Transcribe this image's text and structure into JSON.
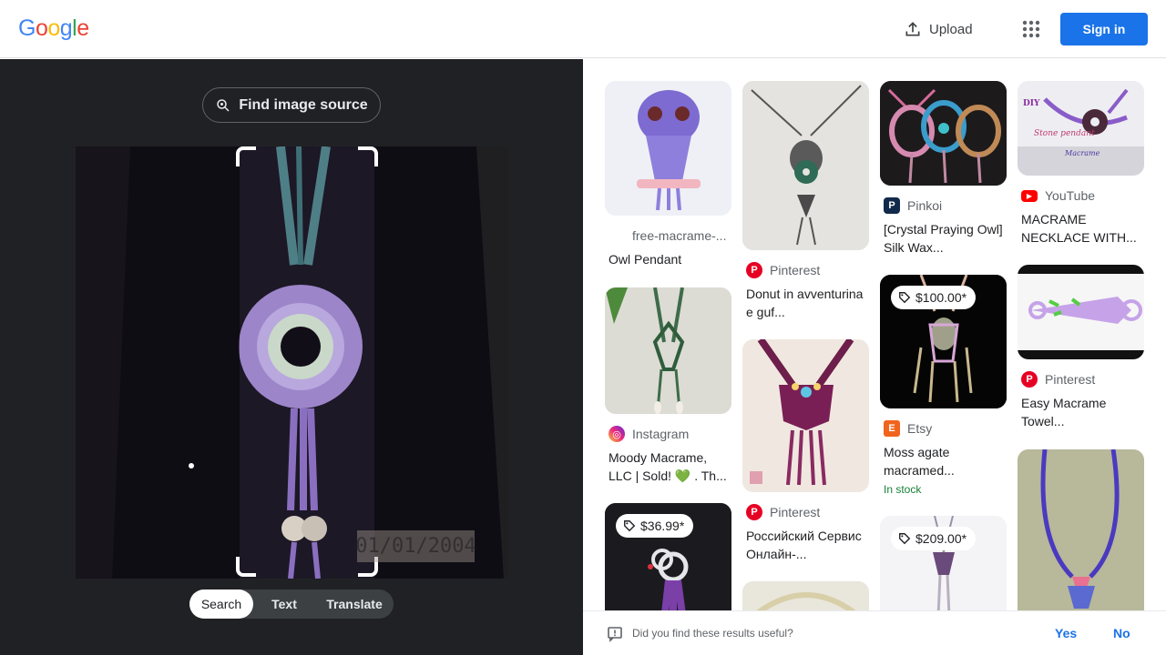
{
  "header": {
    "logo_letters": [
      "G",
      "o",
      "o",
      "g",
      "l",
      "e"
    ],
    "upload_label": "Upload",
    "signin_label": "Sign in"
  },
  "viewer": {
    "find_source_label": "Find image source",
    "datestamp": "01/01/2004",
    "modes": [
      "Search",
      "Text",
      "Translate"
    ],
    "active_mode": "Search"
  },
  "results": [
    {
      "source": "free-macrame-...",
      "title": "Owl Pendant",
      "price": "",
      "stock": "",
      "favicon": "none"
    },
    {
      "source": "Pinterest",
      "title": "Donut in avventurina e guf...",
      "price": "",
      "stock": "",
      "favicon": "pinterest"
    },
    {
      "source": "Pinkoi",
      "title": "[Crystal Praying Owl] Silk Wax...",
      "price": "",
      "stock": "",
      "favicon": "pinkoi"
    },
    {
      "source": "YouTube",
      "title": "MACRAME NECKLACE WITH...",
      "price": "",
      "stock": "",
      "favicon": "youtube",
      "thumb_text": [
        "DIY",
        "Stone pendant",
        "Macrame"
      ]
    },
    {
      "source": "Instagram",
      "title": "Moody Macrame, LLC | Sold! 💚 . Th...",
      "price": "",
      "stock": "",
      "favicon": "instagram"
    },
    {
      "source": "Pinterest",
      "title": "Российский Сервис Онлайн-...",
      "price": "",
      "stock": "",
      "favicon": "pinterest"
    },
    {
      "source": "Etsy",
      "title": "Moss agate macramed...",
      "price": "$100.00*",
      "stock": "In stock",
      "favicon": "etsy"
    },
    {
      "source": "Pinterest",
      "title": "Easy Macrame Towel...",
      "price": "",
      "stock": "",
      "favicon": "pinterest"
    },
    {
      "source": "",
      "title": "",
      "price": "$36.99*",
      "stock": "",
      "favicon": "none"
    },
    {
      "source": "",
      "title": "",
      "price": "",
      "stock": "",
      "favicon": "none"
    },
    {
      "source": "",
      "title": "",
      "price": "$209.00*",
      "stock": "",
      "favicon": "none"
    },
    {
      "source": "",
      "title": "",
      "price": "",
      "stock": "",
      "favicon": "none"
    }
  ],
  "feedback": {
    "question": "Did you find these results useful?",
    "yes": "Yes",
    "no": "No"
  },
  "colors": {
    "accent": "#1a73e8",
    "dark_panel": "#202124",
    "in_stock": "#188038",
    "pinterest": "#e60023",
    "youtube": "#ff0000",
    "etsy": "#f1641e"
  },
  "icons": [
    "upload-icon",
    "apps-grid-icon",
    "lens-search-icon",
    "price-tag-icon",
    "feedback-icon"
  ]
}
